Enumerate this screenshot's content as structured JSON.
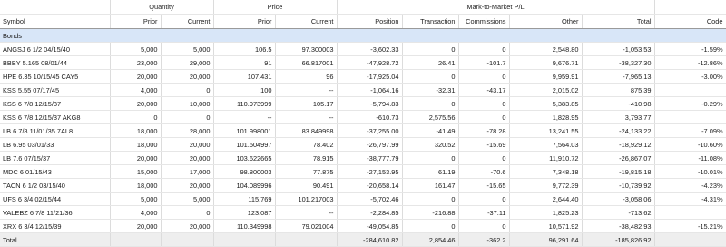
{
  "groups": {
    "quantity": "Quantity",
    "price": "Price",
    "mtm": "Mark-to-Market P/L"
  },
  "headers": {
    "symbol": "Symbol",
    "qty_prior": "Prior",
    "qty_current": "Current",
    "price_prior": "Prior",
    "price_current": "Current",
    "position": "Position",
    "transaction": "Transaction",
    "commissions": "Commissions",
    "other": "Other",
    "total": "Total",
    "code": "Code"
  },
  "section": "Bonds",
  "rows": [
    [
      "ANGSJ 6 1/2 04/15/40",
      "5,000",
      "5,000",
      "106.5",
      "97.300003",
      "-3,602.33",
      "0",
      "0",
      "2,548.80",
      "-1,053.53",
      "-1.59%"
    ],
    [
      "BBBY 5.165 08/01/44",
      "23,000",
      "29,000",
      "91",
      "66.817001",
      "-47,928.72",
      "26.41",
      "-101.7",
      "9,676.71",
      "-38,327.30",
      "-12.86%"
    ],
    [
      "HPE 6.35 10/15/45 CAY5",
      "20,000",
      "20,000",
      "107.431",
      "96",
      "-17,925.04",
      "0",
      "0",
      "9,959.91",
      "-7,965.13",
      "-3.00%"
    ],
    [
      "KSS 5.55 07/17/45",
      "4,000",
      "0",
      "100",
      "--",
      "-1,064.16",
      "-32.31",
      "-43.17",
      "2,015.02",
      "875.39",
      ""
    ],
    [
      "KSS 6 7/8 12/15/37",
      "20,000",
      "10,000",
      "110.973999",
      "105.17",
      "-5,794.83",
      "0",
      "0",
      "5,383.85",
      "-410.98",
      "-0.29%"
    ],
    [
      "KSS 6 7/8 12/15/37 AKG8",
      "0",
      "0",
      "--",
      "--",
      "-610.73",
      "2,575.56",
      "0",
      "1,828.95",
      "3,793.77",
      ""
    ],
    [
      "LB 6 7/8 11/01/35 7AL8",
      "18,000",
      "28,000",
      "101.998001",
      "83.849998",
      "-37,255.00",
      "-41.49",
      "-78.28",
      "13,241.55",
      "-24,133.22",
      "-7.09%"
    ],
    [
      "LB 6.95 03/01/33",
      "18,000",
      "20,000",
      "101.504997",
      "78.402",
      "-26,797.99",
      "320.52",
      "-15.69",
      "7,564.03",
      "-18,929.12",
      "-10.60%"
    ],
    [
      "LB 7.6 07/15/37",
      "20,000",
      "20,000",
      "103.622665",
      "78.915",
      "-38,777.79",
      "0",
      "0",
      "11,910.72",
      "-26,867.07",
      "-11.08%"
    ],
    [
      "MDC 6 01/15/43",
      "15,000",
      "17,000",
      "98.800003",
      "77.875",
      "-27,153.95",
      "61.19",
      "-70.6",
      "7,348.18",
      "-19,815.18",
      "-10.01%"
    ],
    [
      "TACN 6 1/2 03/15/40",
      "18,000",
      "20,000",
      "104.089996",
      "90.491",
      "-20,658.14",
      "161.47",
      "-15.65",
      "9,772.39",
      "-10,739.92",
      "-4.23%"
    ],
    [
      "UFS 6 3/4 02/15/44",
      "5,000",
      "5,000",
      "115.769",
      "101.217003",
      "-5,702.46",
      "0",
      "0",
      "2,644.40",
      "-3,058.06",
      "-4.31%"
    ],
    [
      "VALEBZ 6 7/8 11/21/36",
      "4,000",
      "0",
      "123.087",
      "--",
      "-2,284.85",
      "-216.88",
      "-37.11",
      "1,825.23",
      "-713.62",
      ""
    ],
    [
      "XRX 6 3/4 12/15/39",
      "20,000",
      "20,000",
      "110.349998",
      "79.021004",
      "-49,054.85",
      "0",
      "0",
      "10,571.92",
      "-38,482.93",
      "-15.21%"
    ]
  ],
  "total": {
    "label": "Total",
    "position": "-284,610.82",
    "transaction": "2,854.46",
    "commissions": "-362.2",
    "other": "96,291.64",
    "total": "-185,826.92"
  }
}
